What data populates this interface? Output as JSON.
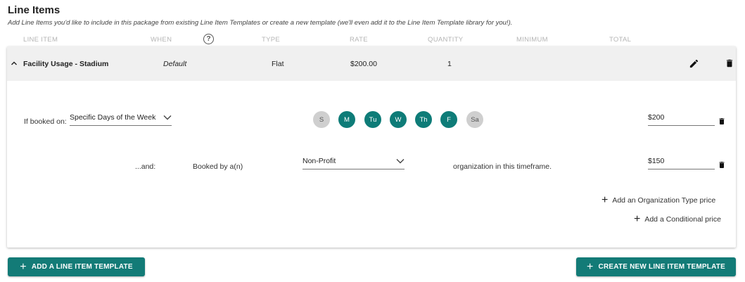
{
  "section": {
    "title": "Line Items",
    "subtitle": "Add Line Items you'd like to include in this package from existing Line Item Templates or create a new template (we'll even add it to the Line Item Template library for you!)."
  },
  "columns": [
    "LINE ITEM",
    "WHEN",
    "TYPE",
    "RATE",
    "QUANTITY",
    "MINIMUM",
    "TOTAL"
  ],
  "help_glyph": "?",
  "line_item": {
    "name": "Facility Usage - Stadium",
    "when": "Default",
    "type": "Flat",
    "rate": "$200.00",
    "quantity": "1"
  },
  "condition_day": {
    "label": "If booked on:",
    "select_value": "Specific Days of the Week",
    "days": [
      {
        "label": "S",
        "selected": false
      },
      {
        "label": "M",
        "selected": true
      },
      {
        "label": "Tu",
        "selected": true
      },
      {
        "label": "W",
        "selected": true
      },
      {
        "label": "Th",
        "selected": true
      },
      {
        "label": "F",
        "selected": true
      },
      {
        "label": "Sa",
        "selected": false
      }
    ],
    "price": "$200"
  },
  "condition_org": {
    "prefix": "...and:",
    "label": "Booked by a(n)",
    "select_value": "Non-Profit",
    "suffix": "organization in this timeframe.",
    "price": "$150"
  },
  "links": {
    "add_org_price": "Add an Organization Type price",
    "add_conditional_price": "Add a Conditional price"
  },
  "buttons": {
    "add_template": "ADD A LINE ITEM TEMPLATE",
    "create_template": "CREATE NEW LINE ITEM TEMPLATE"
  },
  "colors": {
    "accent": "#137b77",
    "day_selected": "#0e7c78",
    "day_unselected": "#cfcfcf"
  }
}
